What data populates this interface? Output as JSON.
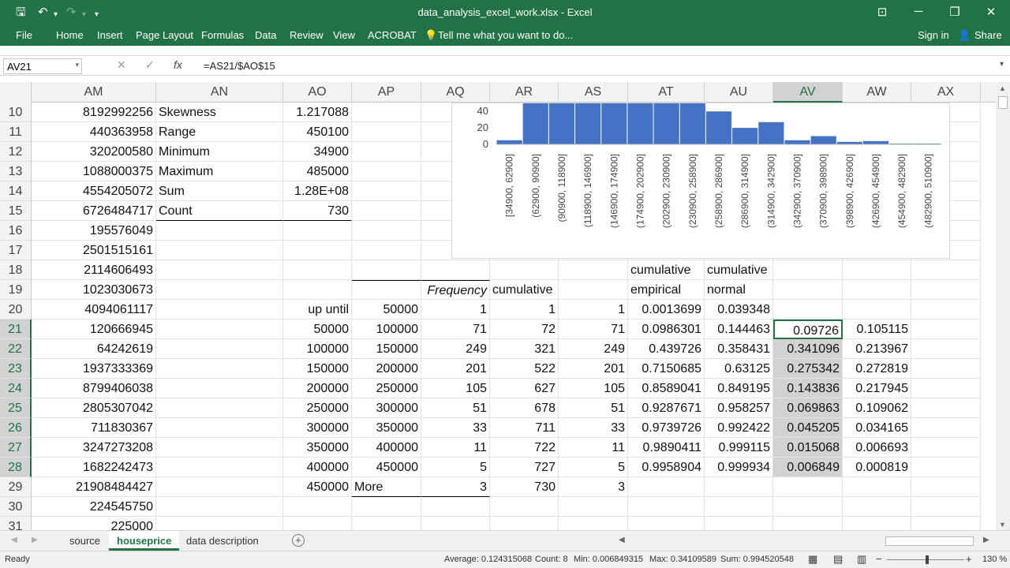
{
  "titlebar": {
    "title": "data_analysis_excel_work.xlsx - Excel",
    "save_icon": "save-icon",
    "undo_icon": "undo-icon",
    "redo_icon": "redo-icon",
    "customize_icon": "customize-qat-icon"
  },
  "ribbon": {
    "tabs": [
      "File",
      "Home",
      "Insert",
      "Page Layout",
      "Formulas",
      "Data",
      "Review",
      "View",
      "ACROBAT"
    ],
    "tell_me": "Tell me what you want to do...",
    "sign_in": "Sign in",
    "share": "Share"
  },
  "formula_bar": {
    "name_box": "AV21",
    "cancel": "✕",
    "enter": "✓",
    "fx": "fx",
    "formula": "=AS21/$AO$15"
  },
  "columns": [
    "AM",
    "AN",
    "AO",
    "AP",
    "AQ",
    "AR",
    "AS",
    "AT",
    "AU",
    "AV",
    "AW",
    "AX"
  ],
  "selected_column": "AV",
  "rows": [
    {
      "n": "10",
      "cells": {
        "AM": "8192992256",
        "AN": "Skewness",
        "AO": "1.217088"
      }
    },
    {
      "n": "11",
      "cells": {
        "AM": "440363958",
        "AN": "Range",
        "AO": "450100"
      }
    },
    {
      "n": "12",
      "cells": {
        "AM": "320200580",
        "AN": "Minimum",
        "AO": "34900"
      }
    },
    {
      "n": "13",
      "cells": {
        "AM": "1088000375",
        "AN": "Maximum",
        "AO": "485000"
      }
    },
    {
      "n": "14",
      "cells": {
        "AM": "4554205072",
        "AN": "Sum",
        "AO": "1.28E+08"
      }
    },
    {
      "n": "15",
      "cells": {
        "AM": "6726484717",
        "AN": "Count",
        "AO": "730"
      }
    },
    {
      "n": "16",
      "cells": {
        "AM": "195576049"
      }
    },
    {
      "n": "17",
      "cells": {
        "AM": "2501515161"
      }
    },
    {
      "n": "18",
      "cells": {
        "AM": "2114606493",
        "AT": "cumulative",
        "AU": "cumulative"
      }
    },
    {
      "n": "19",
      "cells": {
        "AM": "1023030673",
        "AQ": "Frequency",
        "AR": "cumulative",
        "AT": "empirical",
        "AU": "normal"
      }
    },
    {
      "n": "20",
      "cells": {
        "AM": "4094061117",
        "AO": "up until",
        "AP": "50000",
        "AQ": "1",
        "AR": "1",
        "AS": "1",
        "AT": "0.0013699",
        "AU": "0.039348"
      }
    },
    {
      "n": "21",
      "cells": {
        "AM": "120666945",
        "AO": "50000",
        "AP": "100000",
        "AQ": "71",
        "AR": "72",
        "AS": "71",
        "AT": "0.0986301",
        "AU": "0.144463",
        "AV": "0.09726",
        "AW": "0.105115"
      }
    },
    {
      "n": "22",
      "cells": {
        "AM": "64242619",
        "AO": "100000",
        "AP": "150000",
        "AQ": "249",
        "AR": "321",
        "AS": "249",
        "AT": "0.439726",
        "AU": "0.358431",
        "AV": "0.341096",
        "AW": "0.213967"
      }
    },
    {
      "n": "23",
      "cells": {
        "AM": "1937333369",
        "AO": "150000",
        "AP": "200000",
        "AQ": "201",
        "AR": "522",
        "AS": "201",
        "AT": "0.7150685",
        "AU": "0.63125",
        "AV": "0.275342",
        "AW": "0.272819"
      }
    },
    {
      "n": "24",
      "cells": {
        "AM": "8799406038",
        "AO": "200000",
        "AP": "250000",
        "AQ": "105",
        "AR": "627",
        "AS": "105",
        "AT": "0.8589041",
        "AU": "0.849195",
        "AV": "0.143836",
        "AW": "0.217945"
      }
    },
    {
      "n": "25",
      "cells": {
        "AM": "2805307042",
        "AO": "250000",
        "AP": "300000",
        "AQ": "51",
        "AR": "678",
        "AS": "51",
        "AT": "0.9287671",
        "AU": "0.958257",
        "AV": "0.069863",
        "AW": "0.109062"
      }
    },
    {
      "n": "26",
      "cells": {
        "AM": "711830367",
        "AO": "300000",
        "AP": "350000",
        "AQ": "33",
        "AR": "711",
        "AS": "33",
        "AT": "0.9739726",
        "AU": "0.992422",
        "AV": "0.045205",
        "AW": "0.034165"
      }
    },
    {
      "n": "27",
      "cells": {
        "AM": "3247273208",
        "AO": "350000",
        "AP": "400000",
        "AQ": "11",
        "AR": "722",
        "AS": "11",
        "AT": "0.9890411",
        "AU": "0.999115",
        "AV": "0.015068",
        "AW": "0.006693"
      }
    },
    {
      "n": "28",
      "cells": {
        "AM": "1682242473",
        "AO": "400000",
        "AP": "450000",
        "AQ": "5",
        "AR": "727",
        "AS": "5",
        "AT": "0.9958904",
        "AU": "0.999934",
        "AV": "0.006849",
        "AW": "0.000819"
      }
    },
    {
      "n": "29",
      "cells": {
        "AM": "21908484427",
        "AO": "450000",
        "AP": "More",
        "AQ": "3",
        "AR": "730",
        "AS": "3"
      }
    },
    {
      "n": "30",
      "cells": {
        "AM": "224545750"
      }
    },
    {
      "n": "31",
      "cells": {
        "AM": "225000"
      }
    }
  ],
  "chart_data": {
    "type": "bar",
    "categories": [
      "[34900, 62900]",
      "(62900, 90900]",
      "(90900, 118900]",
      "(118900, 146900]",
      "(146900, 174900]",
      "(174900, 202900]",
      "(202900, 230900]",
      "(230900, 258900]",
      "(258900, 286900]",
      "(286900, 314900]",
      "(314900, 342900]",
      "(342900, 370900]",
      "(370900, 398900]",
      "(398900, 426900]",
      "(426900, 454900]",
      "(454900, 482900]",
      "(482900, 510900]"
    ],
    "values": [
      5,
      90,
      110,
      125,
      120,
      118,
      105,
      85,
      40,
      20,
      27,
      5,
      10,
      3,
      4,
      1,
      1
    ],
    "ytick_labels": [
      "0",
      "20",
      "40"
    ],
    "ytick_values": [
      0,
      20,
      40
    ],
    "visible_ylim": [
      0,
      45
    ],
    "color": "#4472c4"
  },
  "sheets": {
    "tabs": [
      "source",
      "houseprice",
      "data description"
    ],
    "active": "houseprice",
    "add_label": "+"
  },
  "status": {
    "ready": "Ready",
    "average": "Average: 0.124315068",
    "count": "Count: 8",
    "min": "Min: 0.006849315",
    "max": "Max: 0.34109589",
    "sum": "Sum: 0.994520548",
    "zoom": "130 %",
    "zoom_minus": "−",
    "zoom_plus": "+"
  }
}
